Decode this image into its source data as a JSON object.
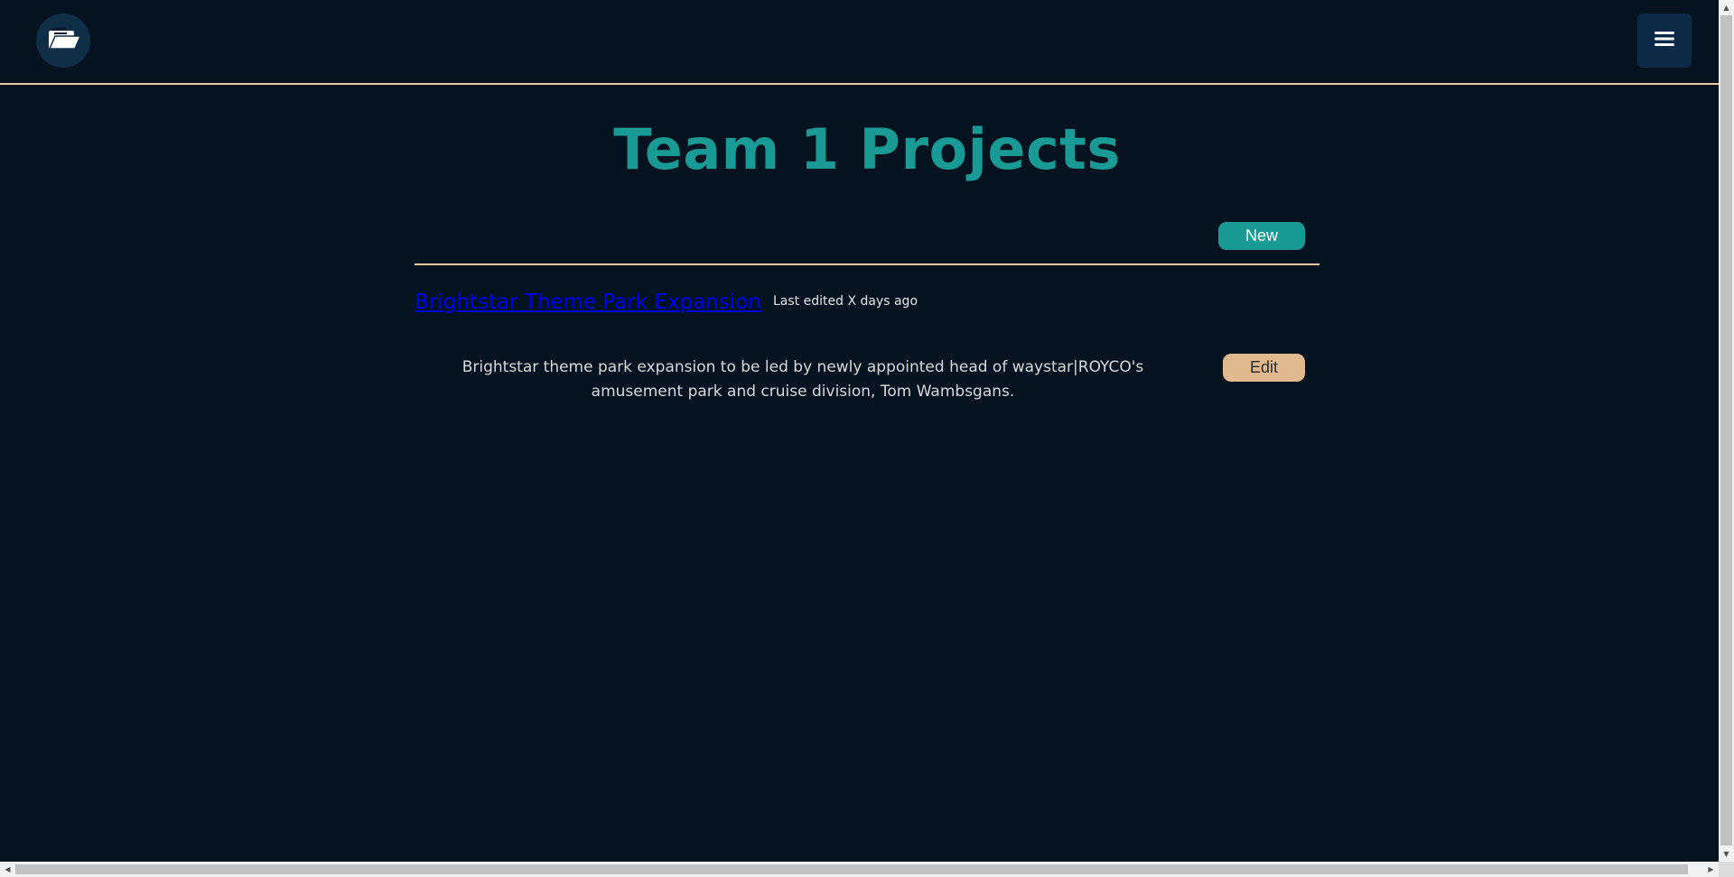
{
  "header": {
    "logo_icon": "folder-icon",
    "menu_icon": "hamburger-menu-icon"
  },
  "page": {
    "title": "Team 1 Projects",
    "new_label": "New"
  },
  "projects": [
    {
      "name": "Brightstar Theme Park Expansion",
      "last_edited": "Last edited X days ago",
      "description": "Brightstar theme park expansion to be led by newly appointed head of waystar|ROYCO's amusement park and cruise division, Tom Wambsgans.",
      "edit_label": "Edit"
    }
  ],
  "colors": {
    "background": "#051320",
    "accent": "#1a9a94",
    "divider": "#e8c9a0",
    "edit_button": "#e2b98f",
    "link": "#0000ee"
  }
}
